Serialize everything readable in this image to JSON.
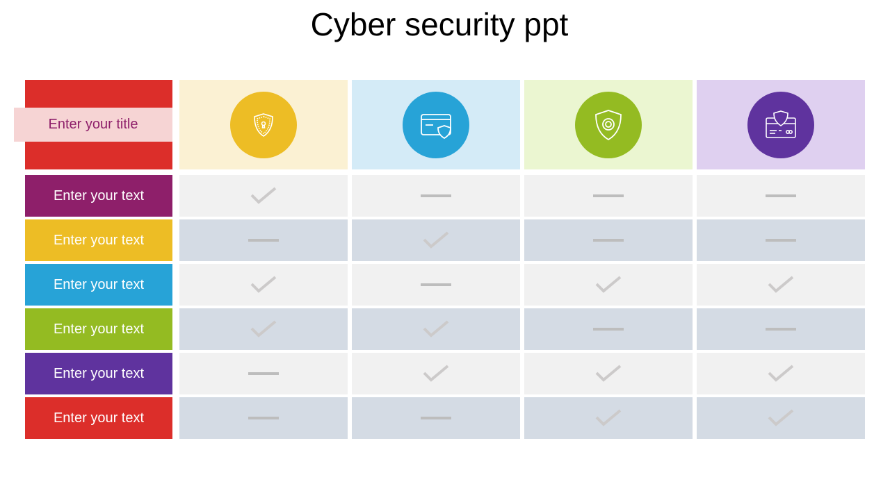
{
  "slide": {
    "title": "Cyber security ppt",
    "header_title": "Enter your title"
  },
  "colors": {
    "red": "#dc2e2a",
    "magenta": "#8e1f6a",
    "yellow": "#edbd25",
    "blue": "#27a3d7",
    "green": "#94bb22",
    "purple": "#5f339e",
    "row_light": "#f1f1f1",
    "row_dark": "#d4dbe4"
  },
  "columns": [
    {
      "icon": "shield-keyhole-icon",
      "circle_color": "#edbd25",
      "bg_color": "#fbf1d3"
    },
    {
      "icon": "credit-card-shield-icon",
      "circle_color": "#27a3d7",
      "bg_color": "#d4ebf7"
    },
    {
      "icon": "shield-eye-icon",
      "circle_color": "#94bb22",
      "bg_color": "#ebf6d1"
    },
    {
      "icon": "card-reader-shield-icon",
      "circle_color": "#5f339e",
      "bg_color": "#dfd0f0"
    }
  ],
  "rows": [
    {
      "label": "Enter your text",
      "color": "#8e1f6a",
      "values": [
        "check",
        "dash",
        "dash",
        "dash"
      ]
    },
    {
      "label": "Enter your text",
      "color": "#edbd25",
      "values": [
        "dash",
        "check",
        "dash",
        "dash"
      ]
    },
    {
      "label": "Enter your text",
      "color": "#27a3d7",
      "values": [
        "check",
        "dash",
        "check",
        "check"
      ]
    },
    {
      "label": "Enter your text",
      "color": "#94bb22",
      "values": [
        "check",
        "check",
        "dash",
        "dash"
      ]
    },
    {
      "label": "Enter your text",
      "color": "#5f339e",
      "values": [
        "dash",
        "check",
        "check",
        "check"
      ]
    },
    {
      "label": "Enter your text",
      "color": "#dc2e2a",
      "values": [
        "dash",
        "dash",
        "check",
        "check"
      ]
    }
  ]
}
